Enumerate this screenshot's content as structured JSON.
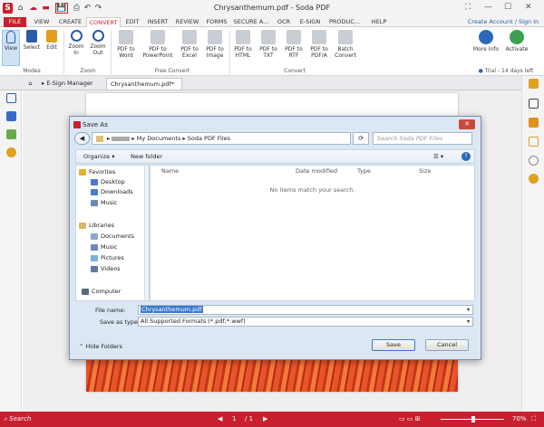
{
  "window": {
    "title": "Chrysanthemum.pdf",
    "app_name": "Soda PDF"
  },
  "menu": {
    "items": [
      "FILE",
      "VIEW",
      "CREATE",
      "CONVERT",
      "EDIT",
      "INSERT",
      "REVIEW",
      "FORMS",
      "SECURE A...",
      "OCR",
      "E-SIGN",
      "PRODUC...",
      "HELP"
    ],
    "active": "CONVERT"
  },
  "account": {
    "link": "Create Account / Sign In"
  },
  "ribbon": {
    "modes": [
      "View",
      "Select",
      "Edit"
    ],
    "zoom": [
      "Zoom In",
      "Zoom Out"
    ],
    "free_convert": [
      "PDF to Word",
      "PDF to PowerPoint",
      "PDF to Excel",
      "PDF to Image"
    ],
    "convert": [
      "PDF to HTML",
      "PDF to TXT",
      "PDF to RTF",
      "PDF to PDF/A",
      "Batch Convert"
    ],
    "right": [
      "More Info",
      "Activate"
    ],
    "groups": {
      "modes": "Modes",
      "zoom": "Zoom",
      "free_convert": "Free Convert",
      "convert": "Convert"
    },
    "trial": "Trial - 14 days left"
  },
  "tabs": {
    "esign": "E-Sign Manager",
    "doc": "Chrysanthemum.pdf*"
  },
  "dialog": {
    "title": "Save As",
    "path": [
      "My Documents",
      "Soda PDF Files"
    ],
    "search_placeholder": "Search Soda PDF Files",
    "organize": "Organize",
    "new_folder": "New folder",
    "nav": {
      "favorites": "Favorites",
      "fav_items": [
        "Desktop",
        "Downloads",
        "Music"
      ],
      "libraries": "Libraries",
      "lib_items": [
        "Documents",
        "Music",
        "Pictures",
        "Videos"
      ],
      "computer": "Computer"
    },
    "columns": [
      "Name",
      "Date modified",
      "Type",
      "Size"
    ],
    "empty": "No items match your search.",
    "file_name_label": "File name:",
    "file_name": "Chrysanthemum.pdf",
    "save_type_label": "Save as type:",
    "save_type": "All Supported Formats (*.pdf;*.wwf)",
    "hide_folders": "Hide Folders",
    "save": "Save",
    "cancel": "Cancel"
  },
  "status": {
    "search": "Search",
    "page": "1",
    "pages": "/ 1",
    "zoom": "70%"
  }
}
